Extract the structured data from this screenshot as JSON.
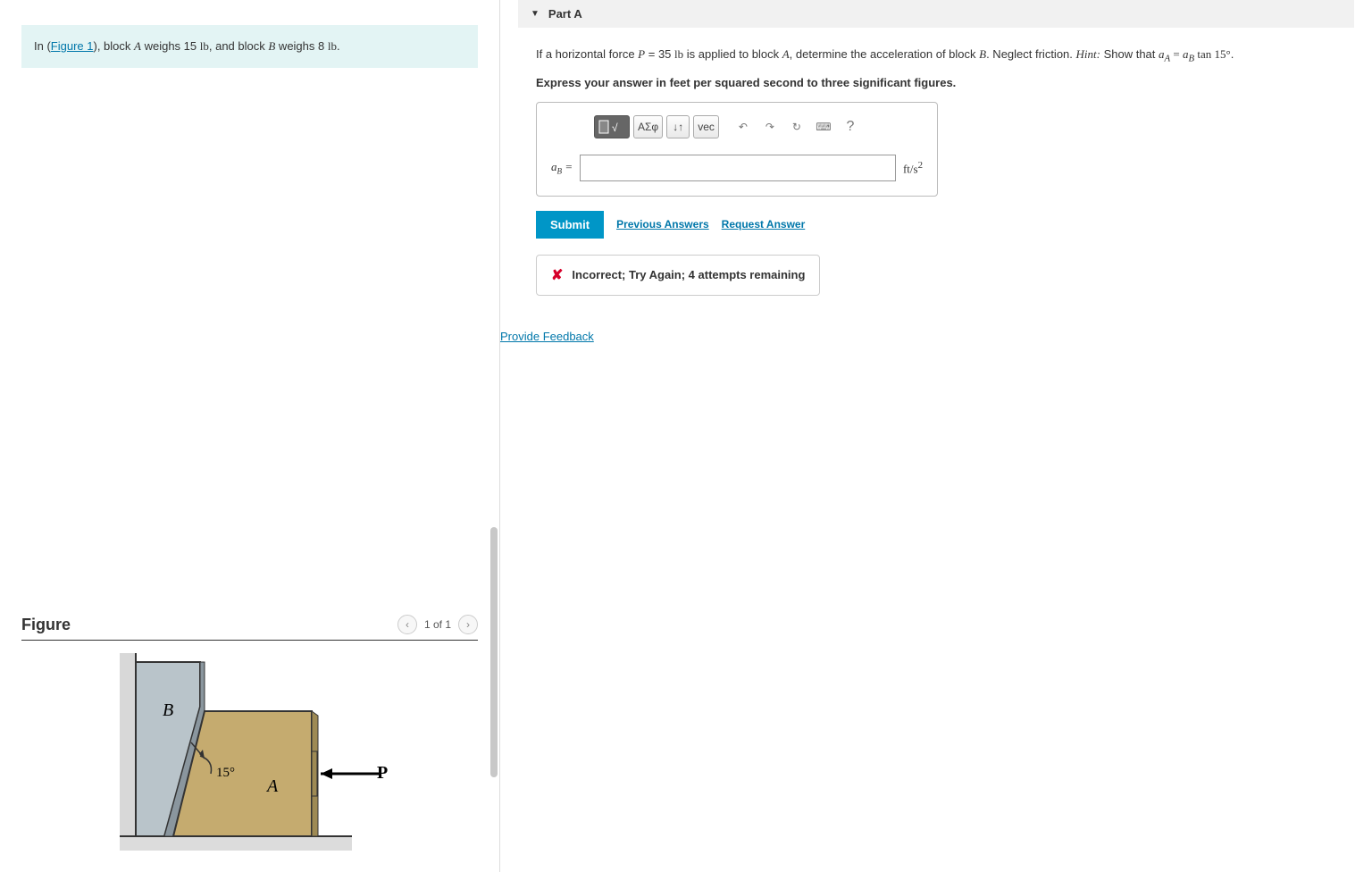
{
  "problem": {
    "prefix": "In (",
    "figure_link": "Figure 1",
    "after_link": "), block ",
    "blockA": "A",
    "weighsA": " weighs 15 ",
    "lb1": "lb",
    "mid": ", and block ",
    "blockB": "B",
    "weighsB": " weighs 8 ",
    "lb2": "lb",
    "end": "."
  },
  "figure": {
    "title": "Figure",
    "counter": "1 of 1",
    "labelB": "B",
    "labelA": "A",
    "angle": "15°",
    "force": "P"
  },
  "part": {
    "label": "Part A"
  },
  "question": {
    "t1": "If a horizontal force ",
    "P": "P",
    "eq": " = 35 ",
    "lb": "lb",
    "t2": " is applied to block ",
    "A": "A",
    "t3": ", determine the acceleration of block ",
    "B": "B",
    "t4": ". Neglect friction. ",
    "hint_label": "Hint:",
    "hint_body": " Show that ",
    "aA": "a",
    "subA": "A",
    "eqs": " = ",
    "aB": "a",
    "subB": "B",
    "tan": " tan 15°",
    "dot": "."
  },
  "instruction": "Express your answer in feet per squared second to three significant figures.",
  "toolbar": {
    "templates": "√",
    "greek": "ΑΣφ",
    "subsup": "↓↑",
    "vec": "vec",
    "undo": "↶",
    "redo": "↷",
    "reset": "↻",
    "keyboard": "⌨",
    "help": "?"
  },
  "answer": {
    "var": "a",
    "sub": "B",
    "eq": " =",
    "value": "",
    "unit_ft": "ft/s",
    "unit_exp": "2"
  },
  "actions": {
    "submit": "Submit",
    "previous": "Previous Answers",
    "request": "Request Answer"
  },
  "feedback": {
    "msg": "Incorrect; Try Again; 4 attempts remaining"
  },
  "provide_feedback": "Provide Feedback"
}
